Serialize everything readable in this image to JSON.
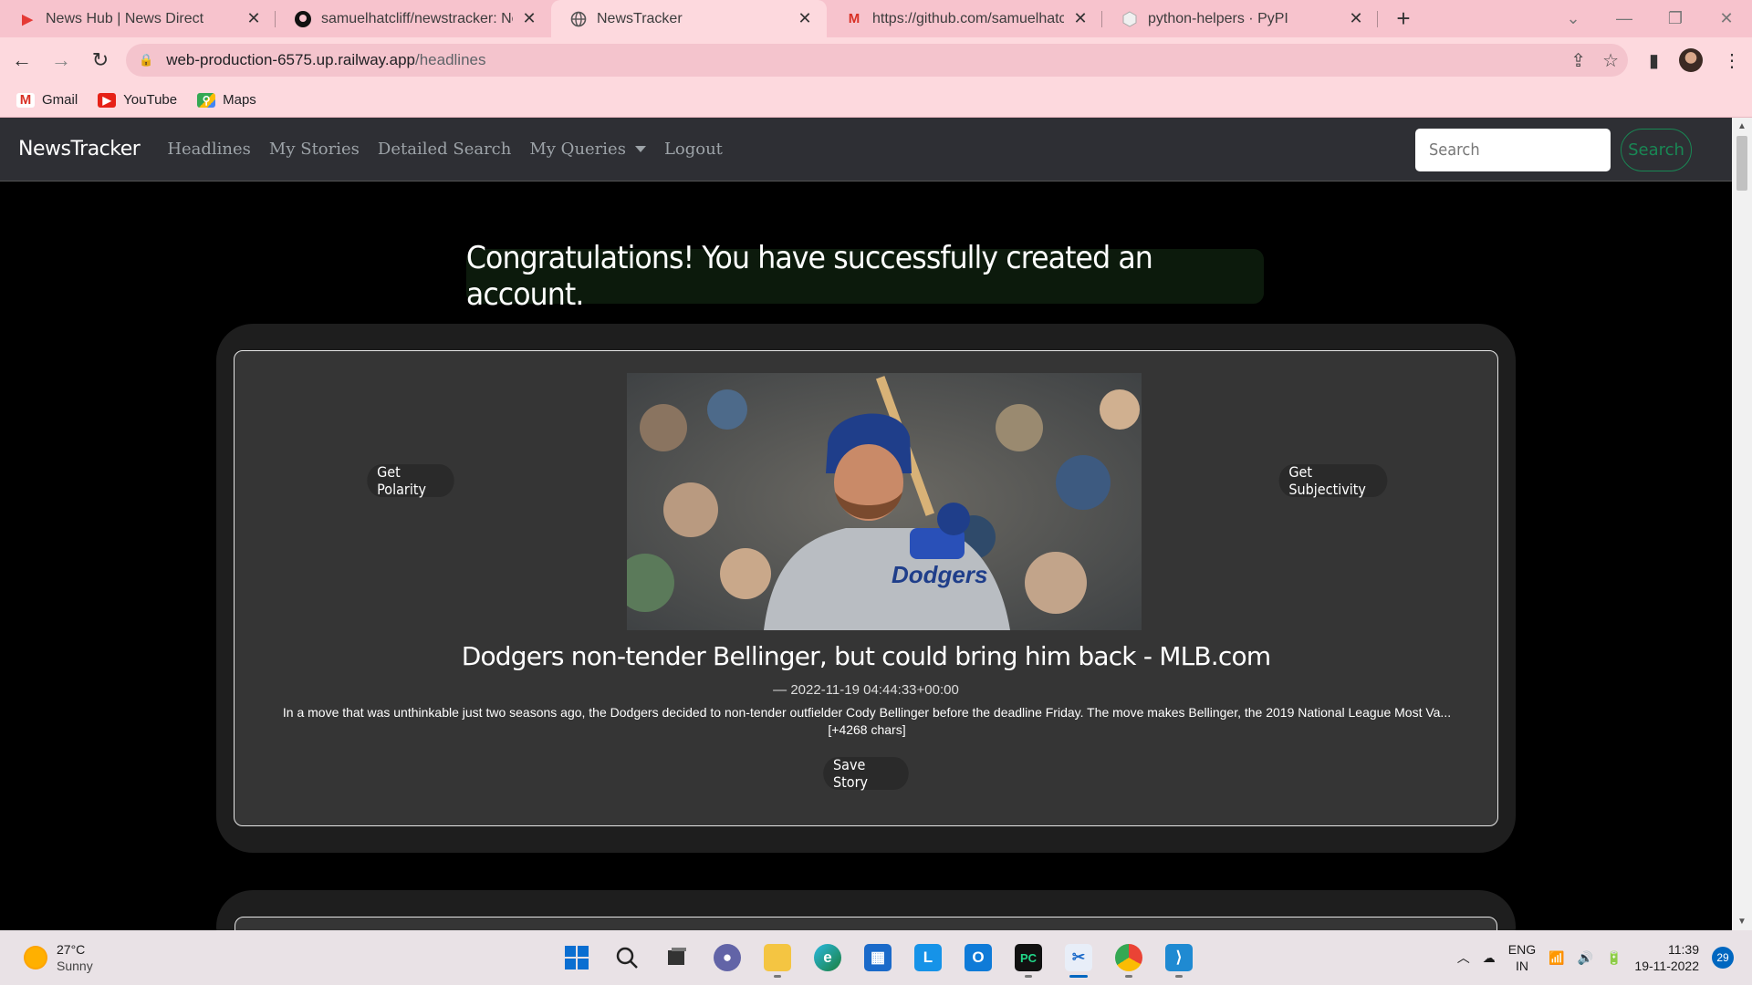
{
  "browser": {
    "tabs": [
      {
        "title": "News Hub | News Direct",
        "icon": "newsdirect-icon",
        "color": "#e53935"
      },
      {
        "title": "samuelhatcliff/newstracker: News",
        "icon": "github-icon",
        "color": "#111111"
      },
      {
        "title": "NewsTracker",
        "icon": "globe-icon",
        "color": "#555555",
        "active": true
      },
      {
        "title": "https://github.com/samuelhatclif",
        "icon": "gmail-icon",
        "color": "#d93025"
      },
      {
        "title": "python-helpers · PyPI",
        "icon": "pypi-icon",
        "color": "#cccccc"
      }
    ],
    "url_host": "web-production-6575.up.railway.app",
    "url_path": "/headlines",
    "bookmarks": [
      {
        "label": "Gmail",
        "icon": "gmail-icon"
      },
      {
        "label": "YouTube",
        "icon": "youtube-icon"
      },
      {
        "label": "Maps",
        "icon": "maps-icon"
      }
    ]
  },
  "site": {
    "brand": "NewsTracker",
    "nav": {
      "headlines": "Headlines",
      "my_stories": "My Stories",
      "detailed_search": "Detailed Search",
      "my_queries": "My Queries",
      "logout": "Logout"
    },
    "search_placeholder": "Search",
    "search_button": "Search",
    "alert": "Congratulations! You have successfully created an account."
  },
  "article": {
    "polarity_button": "Get Polarity",
    "subjectivity_button": "Get Subjectivity",
    "headline": "Dodgers non-tender Bellinger, but could bring him back - MLB.com",
    "date": "— 2022-11-19 04:44:33+00:00",
    "description": "In a move that was unthinkable just two seasons ago, the Dodgers decided to non-tender outfielder Cody Bellinger before the deadline Friday. The move makes Bellinger, the 2019 National League Most Va... [+4268 chars]",
    "save_button": "Save Story"
  },
  "taskbar": {
    "temperature": "27°C",
    "condition": "Sunny",
    "language": "ENG",
    "region": "IN",
    "time": "11:39",
    "date": "19-11-2022",
    "notifications": "29"
  }
}
